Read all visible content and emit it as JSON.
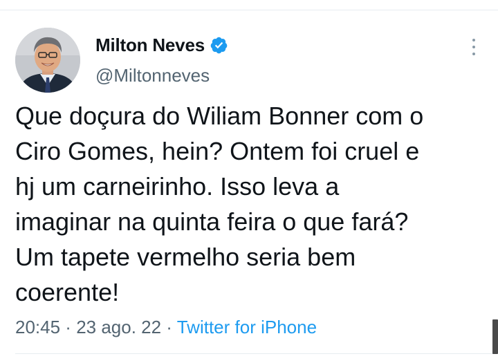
{
  "tweet": {
    "display_name": "Milton Neves",
    "handle": "@Miltonneves",
    "text": "Que doçura do Wiliam Bonner com o\nCiro Gomes, hein? Ontem foi cruel e\nhj um carneirinho. Isso leva a\nimaginar na quinta feira o que fará?\nUm tapete vermelho seria bem\ncoerente!",
    "time": "20:45",
    "date": "23 ago. 22",
    "separator": " · ",
    "source": "Twitter for iPhone"
  },
  "icons": {
    "verified": "verified-badge-icon",
    "more": "more-vertical-icon"
  },
  "colors": {
    "accent": "#1d9bf0",
    "text": "#0f1419",
    "secondary": "#536471"
  }
}
